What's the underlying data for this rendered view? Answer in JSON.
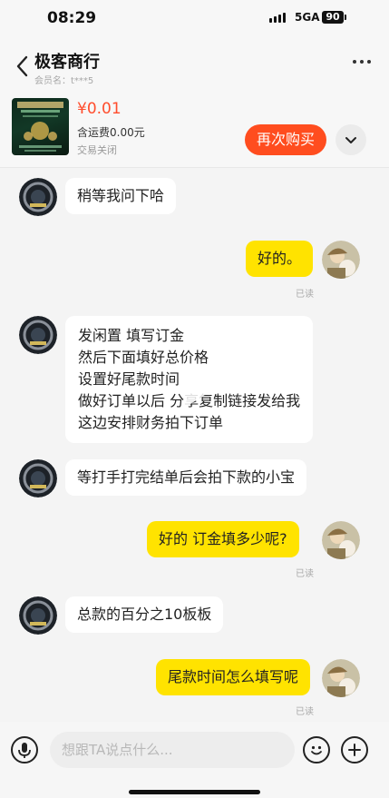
{
  "status_bar": {
    "time": "08:29",
    "network": "5GA",
    "battery": "90"
  },
  "header": {
    "shop_name": "极客商行",
    "member_label": "会员名：t***5"
  },
  "product": {
    "price": "¥0.01",
    "shipping": "含运费0.00元",
    "status": "交易关闭",
    "rebuy_label": "再次购买"
  },
  "messages": [
    {
      "side": "in",
      "lines": [
        "稍等我问下哈"
      ]
    },
    {
      "side": "out",
      "lines": [
        "好的。"
      ],
      "status": "已读"
    },
    {
      "side": "in",
      "lines": [
        "发闲置 填写订金",
        "然后下面填好总价格",
        "设置好尾款时间",
        "做好订单以后 分享复制链接发给我",
        "这边安排财务拍下订单"
      ]
    },
    {
      "side": "in",
      "lines": [
        "等打手打完结单后会拍下款的小宝"
      ]
    },
    {
      "side": "out",
      "lines": [
        "好的 订金填多少呢?"
      ],
      "status": "已读"
    },
    {
      "side": "in",
      "lines": [
        "总款的百分之10板板"
      ]
    },
    {
      "side": "out",
      "lines": [
        "尾款时间怎么填写呢"
      ],
      "status": "已读"
    }
  ],
  "input": {
    "placeholder": "想跟TA说点什么..."
  },
  "icons": {
    "back": "chevron-left-icon",
    "more": "more-dots-icon",
    "expand": "chevron-down-icon",
    "mic": "mic-icon",
    "emoji": "emoji-icon",
    "plus": "plus-icon"
  },
  "colors": {
    "accent": "#ff4d1f",
    "bubble_out": "#ffe300",
    "price": "#ff4d2d"
  }
}
